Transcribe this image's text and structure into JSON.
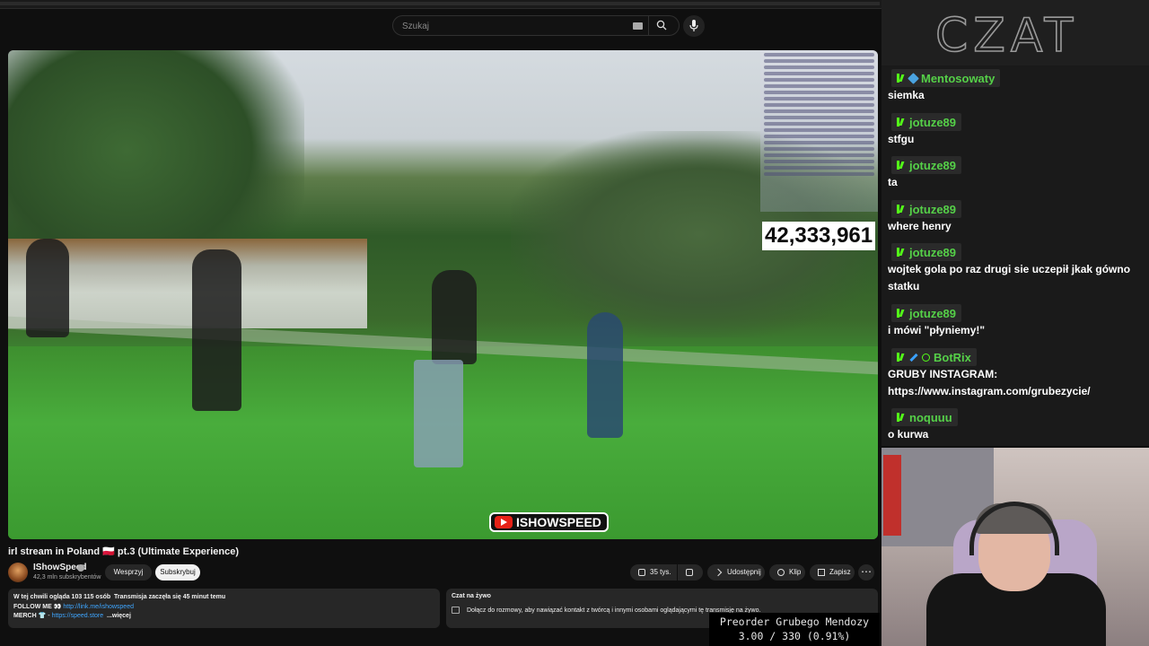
{
  "search": {
    "placeholder": "Szukaj"
  },
  "video": {
    "view_counter": "42,333,961",
    "watermark": "ISHOWSPEED",
    "title": "irl stream in Poland 🇵🇱 pt.3 (Ultimate Experience)"
  },
  "channel": {
    "name": "IShowSpeed",
    "subscribers": "42,3 mln subskrybentów",
    "join_label": "Wesprzyj",
    "subscribe_label": "Subskrybuj"
  },
  "actions": {
    "likes": "35 tys.",
    "share_label": "Udostępnij",
    "clip_label": "Klip",
    "save_label": "Zapisz",
    "more_label": "⋯"
  },
  "description": {
    "line1_bold": "W tej chwili ogląda 103 115 osób",
    "line1_rest": "Transmisja zaczęła się 45 minut temu",
    "line2_label": "FOLLOW ME 👀",
    "line2_link": "http://link.me/ishowspeed",
    "line3_label": "MERCH 👕",
    "line3_link": "https://speed.store",
    "more": "...więcej"
  },
  "live_chat": {
    "title": "Czat na żywo",
    "prompt": "Dołącz do rozmowy, aby nawiązać kontakt z twórcą i innymi osobami oglądającymi tę transmisję na żywo."
  },
  "czat": {
    "logo": "CZAT",
    "messages": [
      {
        "user": "Mentosowaty",
        "text": "siemka",
        "badges": [
          "kick",
          "cube"
        ]
      },
      {
        "user": "jotuze89",
        "text": "stfgu",
        "badges": [
          "kick"
        ]
      },
      {
        "user": "jotuze89",
        "text": "ta",
        "badges": [
          "kick"
        ]
      },
      {
        "user": "jotuze89",
        "text": "where henry",
        "badges": [
          "kick"
        ]
      },
      {
        "user": "jotuze89",
        "text": "wojtek gola po raz drugi sie uczepił jkak gówno statku",
        "badges": [
          "kick"
        ]
      },
      {
        "user": "jotuze89",
        "text": "i mówi \"płyniemy!\"",
        "badges": [
          "kick"
        ]
      },
      {
        "user": "BotRix",
        "text": "GRUBY INSTAGRAM: https://www.instagram.com/grubezycie/",
        "badges": [
          "kick",
          "wrench",
          "check"
        ]
      },
      {
        "user": "noquuu",
        "text": "o kurwa",
        "badges": [
          "kick"
        ]
      }
    ]
  },
  "ticker": {
    "line1": "Preorder Grubego Mendozy",
    "line2": "3.00 / 330 (0.91%)"
  },
  "colors": {
    "accent_green": "#53fc18",
    "username_green": "#55d048",
    "yt_red": "#e62117",
    "link_blue": "#3ea6ff"
  }
}
